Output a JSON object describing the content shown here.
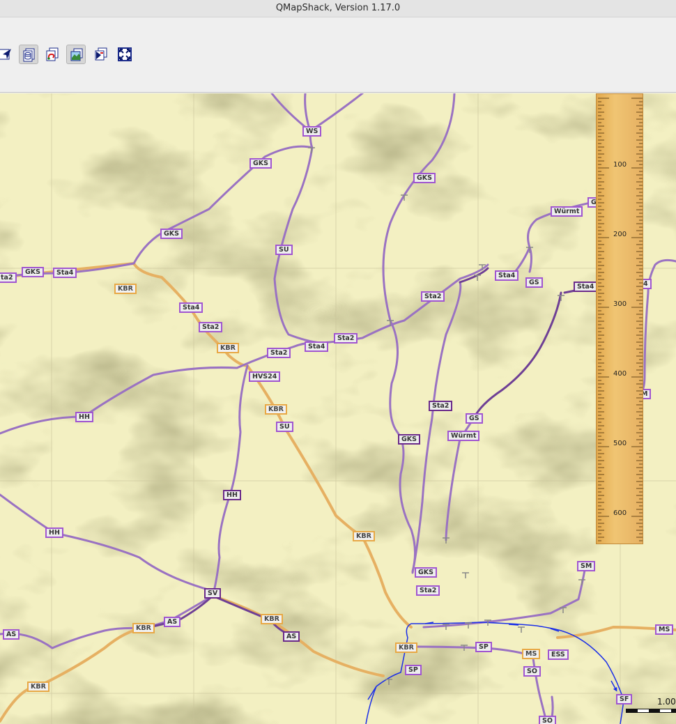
{
  "window": {
    "title": "QMapShack, Version 1.17.0"
  },
  "toolbar": {
    "buttons": [
      {
        "icon": "select-area-icon"
      },
      {
        "icon": "database-icon"
      },
      {
        "icon": "route-icon"
      },
      {
        "icon": "map-view-icon"
      },
      {
        "icon": "dem-view-icon"
      },
      {
        "icon": "fullscreen-icon"
      }
    ]
  },
  "map": {
    "colors": {
      "road": "#9a72c2",
      "road_dark": "#6e3f95",
      "main_road": "#e6b062",
      "track": "#1a2ee8"
    },
    "labels": [
      {
        "text": "WS",
        "style": "purple"
      },
      {
        "text": "GKS",
        "style": "purple"
      },
      {
        "text": "GKS",
        "style": "purple"
      },
      {
        "text": "Würmt",
        "style": "purple"
      },
      {
        "text": "G",
        "style": "purple"
      },
      {
        "text": "GKS",
        "style": "purple"
      },
      {
        "text": "SU",
        "style": "purple"
      },
      {
        "text": "ta2",
        "style": "purple"
      },
      {
        "text": "GKS",
        "style": "purple"
      },
      {
        "text": "Sta4",
        "style": "purple"
      },
      {
        "text": "KBR",
        "style": "orange"
      },
      {
        "text": "Sta4",
        "style": "purple"
      },
      {
        "text": "GS",
        "style": "purple"
      },
      {
        "text": "Sta4",
        "style": "dark"
      },
      {
        "text": "4",
        "style": "purple"
      },
      {
        "text": "Sta2",
        "style": "purple"
      },
      {
        "text": "Sta4",
        "style": "purple"
      },
      {
        "text": "Sta2",
        "style": "purple"
      },
      {
        "text": "KBR",
        "style": "orange"
      },
      {
        "text": "Sta4",
        "style": "purple"
      },
      {
        "text": "Sta2",
        "style": "purple"
      },
      {
        "text": "Sta2",
        "style": "purple"
      },
      {
        "text": "HVS24",
        "style": "purple"
      },
      {
        "text": "M",
        "style": "purple"
      },
      {
        "text": "Sta2",
        "style": "dark"
      },
      {
        "text": "KBR",
        "style": "orange"
      },
      {
        "text": "HH",
        "style": "purple"
      },
      {
        "text": "GS",
        "style": "purple"
      },
      {
        "text": "SU",
        "style": "purple"
      },
      {
        "text": "Würmt",
        "style": "purple"
      },
      {
        "text": "GKS",
        "style": "dark"
      },
      {
        "text": "HH",
        "style": "dark"
      },
      {
        "text": "HH",
        "style": "purple"
      },
      {
        "text": "KBR",
        "style": "orange"
      },
      {
        "text": "SM",
        "style": "purple"
      },
      {
        "text": "GKS",
        "style": "purple"
      },
      {
        "text": "Sta2",
        "style": "purple"
      },
      {
        "text": "SV",
        "style": "dark"
      },
      {
        "text": "KBR",
        "style": "orange"
      },
      {
        "text": "AS",
        "style": "purple"
      },
      {
        "text": "KBR",
        "style": "orange"
      },
      {
        "text": "AS",
        "style": "dark"
      },
      {
        "text": "AS",
        "style": "purple"
      },
      {
        "text": "MS",
        "style": "purple"
      },
      {
        "text": "KBR",
        "style": "orange"
      },
      {
        "text": "SP",
        "style": "purple"
      },
      {
        "text": "MS",
        "style": "orange"
      },
      {
        "text": "ESS",
        "style": "purple"
      },
      {
        "text": "SP",
        "style": "purple"
      },
      {
        "text": "SO",
        "style": "purple"
      },
      {
        "text": "KBR",
        "style": "orange"
      },
      {
        "text": "SF",
        "style": "purple"
      },
      {
        "text": "SO",
        "style": "purple"
      }
    ]
  },
  "ruler": {
    "ticks": [
      "100",
      "200",
      "300",
      "400",
      "500",
      "600"
    ]
  },
  "scale": {
    "value": "1.00"
  }
}
